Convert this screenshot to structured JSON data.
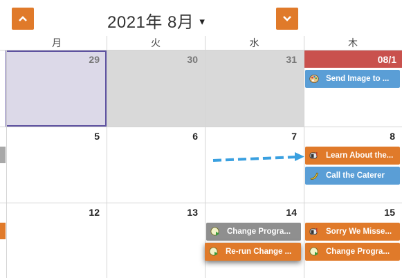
{
  "header": {
    "prev_icon": "chevron-up-icon",
    "next_icon": "chevron-down-icon",
    "month_label": "2021年 8月",
    "caret": "▾"
  },
  "weekdays": [
    "月",
    "火",
    "水",
    "木"
  ],
  "weeks": [
    {
      "days": [
        "29",
        "30",
        "31",
        "08/1"
      ]
    },
    {
      "days": [
        "5",
        "6",
        "7",
        "8"
      ]
    },
    {
      "days": [
        "12",
        "13",
        "14",
        "15"
      ]
    }
  ],
  "events": {
    "send_image": {
      "label": "Send Image to ...",
      "icon": "palette-icon",
      "color": "#5a9ed6"
    },
    "learn_about": {
      "label": "Learn About the...",
      "icon": "mailbox-icon",
      "color": "#e07a2a"
    },
    "call_caterer": {
      "label": "Call the Caterer",
      "icon": "banana-icon",
      "color": "#5a9ed6"
    },
    "change_prog_grey": {
      "label": "Change Progra...",
      "icon": "play-badge-icon",
      "color": "#8f8f8f"
    },
    "rerun_change": {
      "label": "Re-run Change ...",
      "icon": "play-badge-icon",
      "color": "#e07a2a"
    },
    "sorry_missed": {
      "label": "Sorry We Misse...",
      "icon": "mailbox-icon",
      "color": "#e07a2a"
    },
    "change_prog_orange": {
      "label": "Change Progra...",
      "icon": "play-badge-icon",
      "color": "#e07a2a"
    }
  },
  "colors": {
    "accent_orange": "#e07a2a",
    "today_header": "#c9514d",
    "selected_border": "#5e52a0",
    "selected_fill": "#dcd9e8",
    "past_day": "#d9d9d9",
    "drag_arrow": "#3aa0e0"
  }
}
